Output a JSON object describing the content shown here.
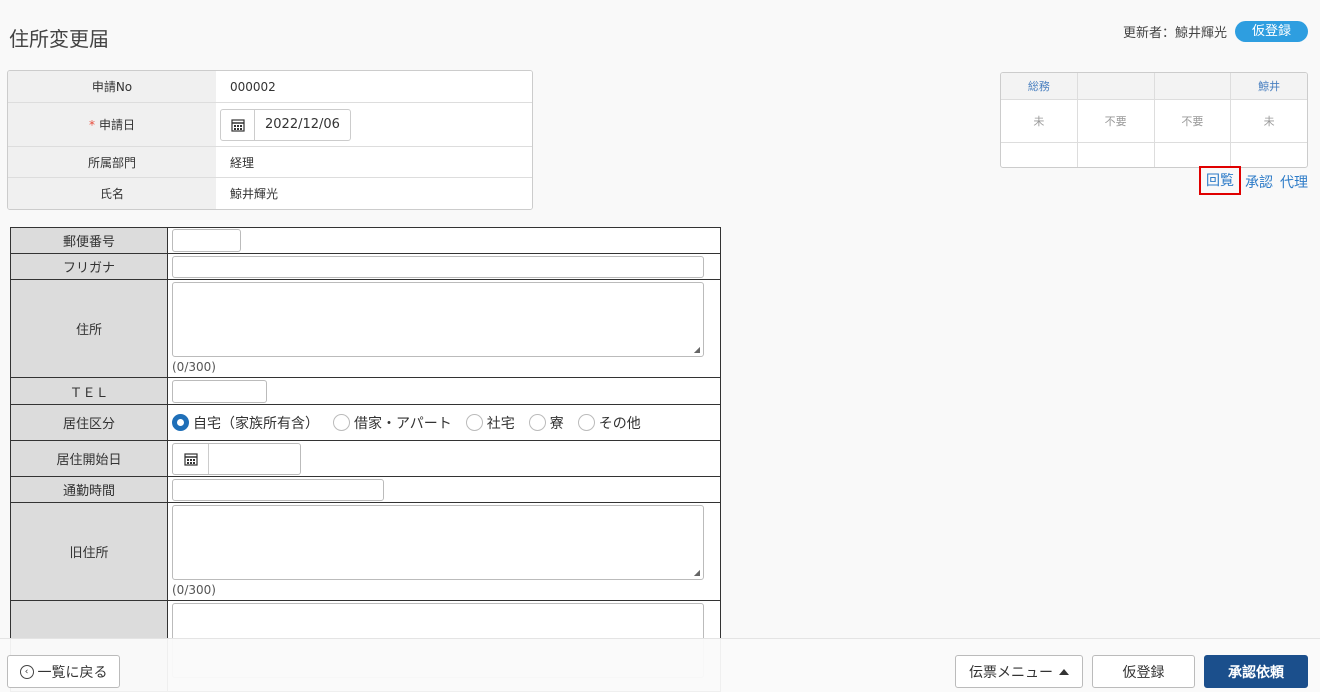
{
  "page": {
    "title": "住所変更届"
  },
  "updater": {
    "text": "更新者：鯨井輝光",
    "status": "仮登録"
  },
  "header_info": {
    "rows": [
      {
        "label": "申請No",
        "value": "000002"
      },
      {
        "label": "申請日",
        "required_mark": "*",
        "value": "2022/12/06"
      },
      {
        "label": "所属部門",
        "value": "経理"
      },
      {
        "label": "氏名",
        "value": "鯨井輝光"
      }
    ]
  },
  "approval": {
    "headers": [
      "総務",
      "",
      "",
      "鯨井"
    ],
    "statuses": [
      "未",
      "不要",
      "不要",
      "未"
    ],
    "actions": [
      "回覧",
      "承認",
      "代理"
    ]
  },
  "form": {
    "postal_label": "郵便番号",
    "furigana_label": "フリガナ",
    "address_label": "住所",
    "address_counter": "(0/300)",
    "tel_label": "ＴＥＬ",
    "residence_type_label": "居住区分",
    "residence_options": [
      "自宅（家族所有含）",
      "借家・アパート",
      "社宅",
      "寮",
      "その他"
    ],
    "residence_selected": "自宅（家族所有含）",
    "residence_start_label": "居住開始日",
    "commute_label": "通勤時間",
    "old_address_label": "旧住所",
    "old_address_counter": "(0/300)"
  },
  "bottom_bar": {
    "back_label": "一覧に戻る",
    "menu_label": "伝票メニュー",
    "draft_label": "仮登録",
    "approve_label": "承認依頼"
  },
  "colors": {
    "accent": "#2e9ee0",
    "primary_button": "#1b4f8c",
    "link": "#2e7cc8",
    "highlight_box": "#e00000"
  }
}
